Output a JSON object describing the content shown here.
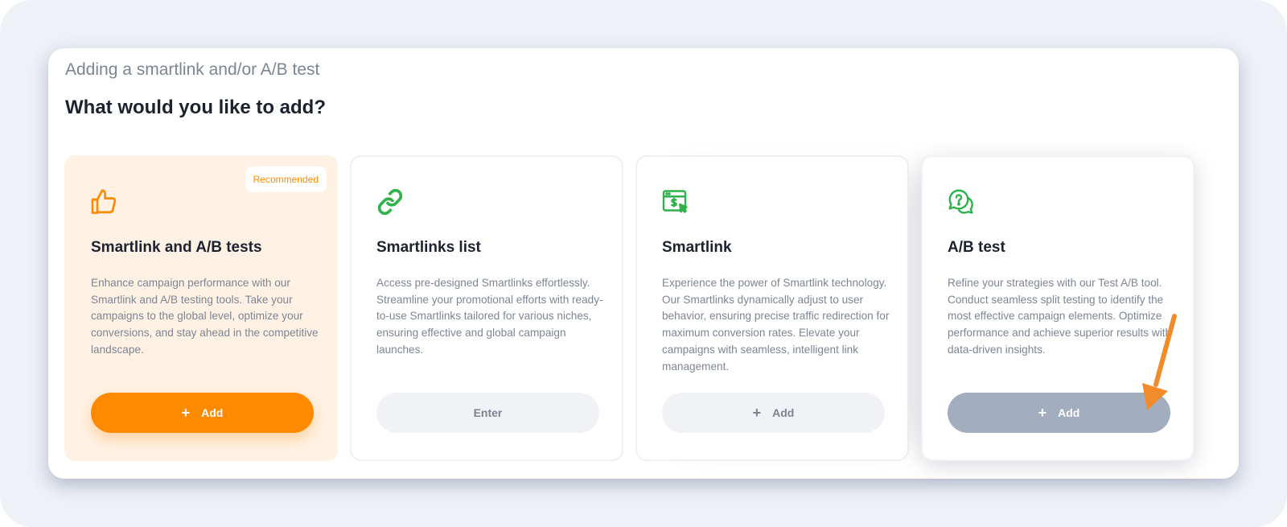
{
  "header": {
    "subtitle": "Adding a smartlink and/or A/B test",
    "title": "What would you like to add?"
  },
  "cards": [
    {
      "icon": "thumbs-up-icon",
      "badge": "Recommended",
      "title": "Smartlink and A/B tests",
      "description": "Enhance campaign performance with our Smartlink and A/B testing tools. Take your campaigns to the global level, optimize your conversions, and stay ahead in the competitive landscape.",
      "button": {
        "icon": "+",
        "label": "Add"
      }
    },
    {
      "icon": "link-icon",
      "title": "Smartlinks list",
      "description": "Access pre-designed Smartlinks effortlessly. Streamline your promotional efforts with ready-to-use Smartlinks tailored for various niches, ensuring effective and global campaign launches.",
      "button": {
        "label": "Enter"
      }
    },
    {
      "icon": "browser-dollar-icon",
      "title": "Smartlink",
      "description": "Experience the power of Smartlink technology. Our Smartlinks dynamically adjust to user behavior, ensuring precise traffic redirection for maximum conversion rates. Elevate your campaigns with seamless, intelligent link management.",
      "button": {
        "icon": "+",
        "label": "Add"
      }
    },
    {
      "icon": "question-chat-icon",
      "title": "A/B test",
      "description": "Refine your strategies with our Test A/B tool. Conduct seamless split testing to identify the most effective campaign elements. Optimize performance and achieve superior results with data-driven insights.",
      "button": {
        "icon": "+",
        "label": "Add"
      }
    }
  ],
  "colors": {
    "accent": "#ff8a00",
    "icon_green": "#2fb24c",
    "annotation_arrow": "#f28c2a"
  }
}
